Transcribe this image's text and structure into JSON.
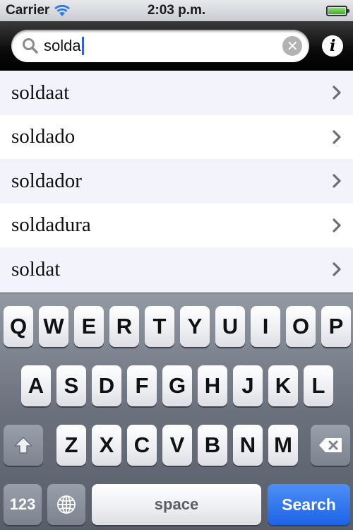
{
  "status_bar": {
    "carrier": "Carrier",
    "time": "2:03 p.m."
  },
  "search": {
    "query": "solda"
  },
  "results": [
    {
      "label": "soldaat"
    },
    {
      "label": "soldado"
    },
    {
      "label": "soldador"
    },
    {
      "label": "soldadura"
    },
    {
      "label": "soldat"
    }
  ],
  "keyboard": {
    "row1": [
      "Q",
      "W",
      "E",
      "R",
      "T",
      "Y",
      "U",
      "I",
      "O",
      "P"
    ],
    "row2": [
      "A",
      "S",
      "D",
      "F",
      "G",
      "H",
      "J",
      "K",
      "L"
    ],
    "row3": [
      "Z",
      "X",
      "C",
      "V",
      "B",
      "N",
      "M"
    ],
    "numbers_label": "123",
    "space_label": "space",
    "search_label": "Search"
  },
  "colors": {
    "accent": "#1d63e6",
    "list_alt": "#f3f3fc",
    "cursor": "#2e63d9"
  }
}
